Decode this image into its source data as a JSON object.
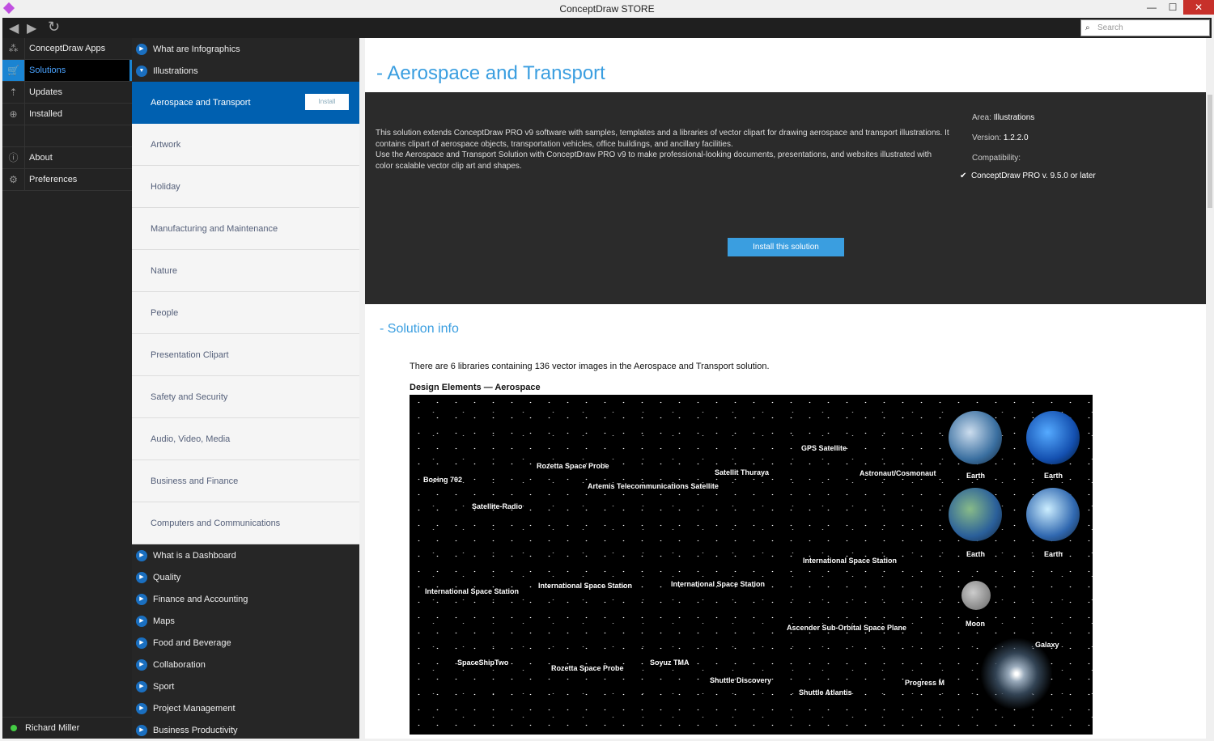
{
  "window": {
    "title": "ConceptDraw STORE",
    "min": "—",
    "max": "☐",
    "close": "✕"
  },
  "toolbar": {
    "back": "◀",
    "forward": "▶",
    "refresh": "↻",
    "search_placeholder": "Search",
    "search_icon": "⌕"
  },
  "leftnav": {
    "items": [
      {
        "label": "ConceptDraw Apps",
        "icon": "⁂"
      },
      {
        "label": "Solutions",
        "icon": "🛒"
      },
      {
        "label": "Updates",
        "icon": "⇡"
      },
      {
        "label": "Installed",
        "icon": "⊕"
      },
      {
        "label": "About",
        "icon": "ⓘ"
      },
      {
        "label": "Preferences",
        "icon": "⚙"
      }
    ],
    "user": "Richard Miller"
  },
  "categories_top": [
    {
      "label": "What are Infographics",
      "icon": "▶"
    },
    {
      "label": "Illustrations",
      "icon": "▼"
    }
  ],
  "active_solution": {
    "label": "Aerospace and Transport",
    "button": "Install"
  },
  "solutions": [
    "Artwork",
    "Holiday",
    "Manufacturing and Maintenance",
    "Nature",
    "People",
    "Presentation Clipart",
    "Safety and Security",
    "Audio, Video, Media",
    "Business and Finance",
    "Computers and Communications"
  ],
  "categories_bottom": [
    "What is a Dashboard",
    "Quality",
    "Finance and Accounting",
    "Maps",
    "Food and Beverage",
    "Collaboration",
    "Sport",
    "Project Management",
    "Business Productivity"
  ],
  "main": {
    "title": "- Aerospace and Transport",
    "desc1": "This solution extends ConceptDraw PRO v9 software with samples, templates and a libraries of vector clipart for drawing aerospace and transport illustrations. It contains clipart of aerospace objects, transportation vehicles, office buildings, and ancillary facilities.",
    "desc2": "Use the Aerospace and Transport Solution with ConceptDraw PRO v9 to make professional-looking documents, presentations, and websites illustrated with color scalable vector clip art and shapes.",
    "area_label": "Area:",
    "area": "Illustrations",
    "version_label": "Version:",
    "version": "1.2.2.0",
    "compat_label": "Compatibility:",
    "compat": "ConceptDraw PRO v. 9.5.0 or later",
    "check": "✔",
    "install_button": "Install this solution",
    "info_title": "- Solution info",
    "intro": "There are 6 libraries containing 136 vector images in the Aerospace and Transport solution.",
    "design_title": "Design Elements — Aerospace",
    "image_labels": [
      "Boeing 702",
      "Rozetta Space Probe",
      "Artemis Telecommunications Satellite",
      "Satellit Thuraya",
      "GPS Satellite",
      "Astronaut/Cosmonaut",
      "Earth",
      "Earth",
      "Satellite-Radio",
      "Earth",
      "Earth",
      "International Space Station",
      "International Space Station",
      "International Space Station",
      "International Space Station",
      "Ascender Sub-Orbital Space Plane",
      "Moon",
      "Galaxy",
      "SpaceShipTwo",
      "Rozetta Space Probe",
      "Soyuz TMA",
      "Shuttle Discovery",
      "Shuttle Atlantis",
      "Progress M"
    ]
  }
}
